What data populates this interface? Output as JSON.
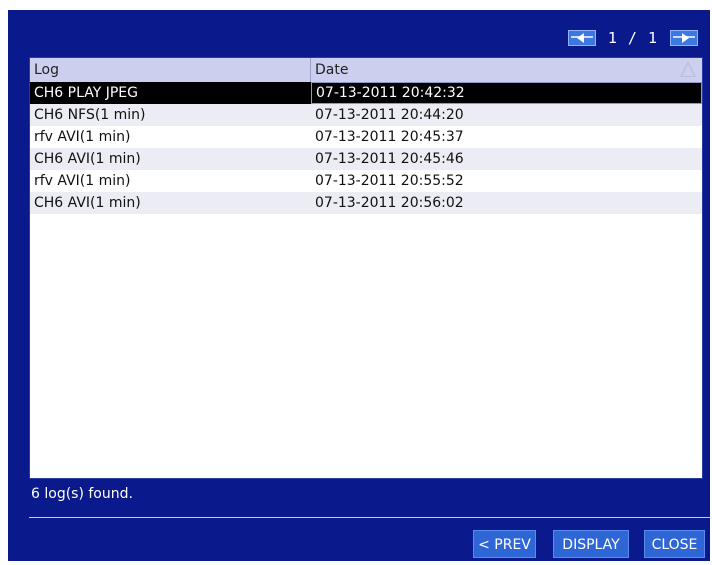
{
  "pager": {
    "page_text": "1 / 1"
  },
  "table": {
    "columns": [
      "Log",
      "Date"
    ],
    "rows": [
      {
        "log": "CH6 PLAY JPEG",
        "date": "07-13-2011 20:42:32"
      },
      {
        "log": "CH6 NFS(1 min)",
        "date": "07-13-2011 20:44:20"
      },
      {
        "log": "rfv AVI(1 min)",
        "date": "07-13-2011 20:45:37"
      },
      {
        "log": "CH6 AVI(1 min)",
        "date": "07-13-2011 20:45:46"
      },
      {
        "log": "rfv AVI(1 min)",
        "date": "07-13-2011 20:55:52"
      },
      {
        "log": "CH6 AVI(1 min)",
        "date": "07-13-2011 20:56:02"
      }
    ],
    "selected_row": 0
  },
  "status": {
    "text": "6 log(s) found."
  },
  "buttons": {
    "prev": "< PREV",
    "display": "DISPLAY",
    "close": "CLOSE"
  },
  "colors": {
    "background": "#0a1a8c",
    "button": "#2f66d6",
    "header": "#ccd0ee"
  }
}
